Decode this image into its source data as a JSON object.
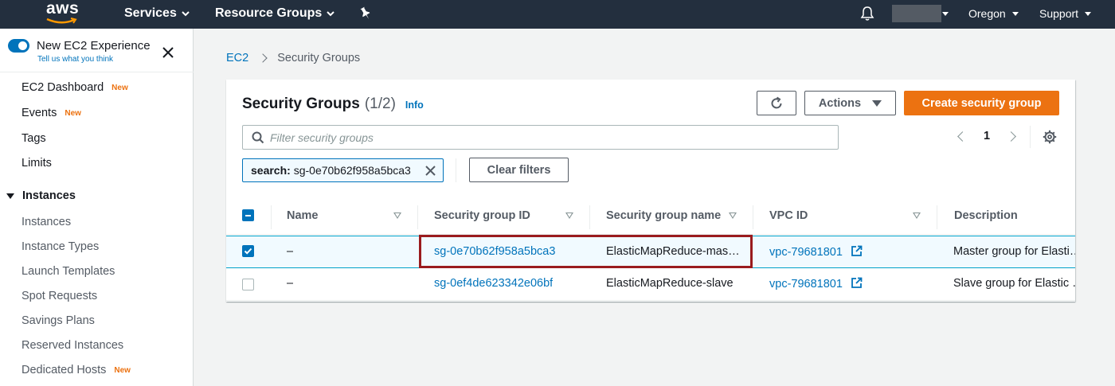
{
  "topnav": {
    "logo_text": "aws",
    "services": "Services",
    "resource_groups": "Resource Groups",
    "region": "Oregon",
    "support": "Support"
  },
  "sidebar": {
    "experience_title": "New EC2 Experience",
    "experience_sub": "Tell us what you think",
    "items_top": [
      {
        "label": "EC2 Dashboard",
        "badge": "New"
      },
      {
        "label": "Events",
        "badge": "New"
      },
      {
        "label": "Tags",
        "badge": ""
      },
      {
        "label": "Limits",
        "badge": ""
      }
    ],
    "section": "Instances",
    "items_instances": [
      {
        "label": "Instances",
        "badge": ""
      },
      {
        "label": "Instance Types",
        "badge": ""
      },
      {
        "label": "Launch Templates",
        "badge": ""
      },
      {
        "label": "Spot Requests",
        "badge": ""
      },
      {
        "label": "Savings Plans",
        "badge": ""
      },
      {
        "label": "Reserved Instances",
        "badge": ""
      },
      {
        "label": "Dedicated Hosts",
        "badge": "New"
      }
    ]
  },
  "breadcrumb": {
    "root": "EC2",
    "current": "Security Groups"
  },
  "panel": {
    "title": "Security Groups",
    "count": "(1/2)",
    "info": "Info",
    "actions": "Actions",
    "create": "Create security group",
    "search_placeholder": "Filter security groups",
    "page": "1",
    "token_key": "search:",
    "token_value": "sg-0e70b62f958a5bca3",
    "clear_filters": "Clear filters"
  },
  "table": {
    "columns": [
      "Name",
      "Security group ID",
      "Security group name",
      "VPC ID",
      "Description"
    ],
    "rows": [
      {
        "selected": true,
        "name": "–",
        "sg_id": "sg-0e70b62f958a5bca3",
        "sg_name": "ElasticMapReduce-mas…",
        "vpc": "vpc-79681801",
        "description": "Master group for Elasti…"
      },
      {
        "selected": false,
        "name": "–",
        "sg_id": "sg-0ef4de623342e06bf",
        "sg_name": "ElasticMapReduce-slave",
        "vpc": "vpc-79681801",
        "description": "Slave group for Elastic …"
      }
    ]
  },
  "colors": {
    "accent": "#0073bb",
    "orange": "#ec7211",
    "highlight": "#9a1b1e",
    "nav": "#232f3e"
  }
}
